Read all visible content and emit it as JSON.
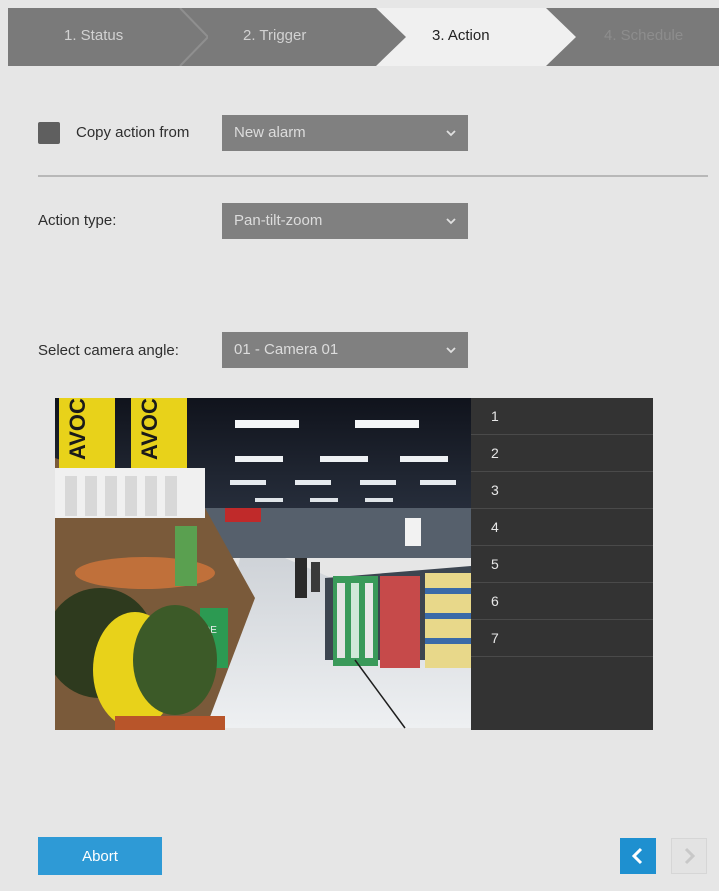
{
  "wizard": {
    "steps": [
      {
        "label": "1. Status",
        "state": "done"
      },
      {
        "label": "2. Trigger",
        "state": "done"
      },
      {
        "label": "3. Action",
        "state": "active"
      },
      {
        "label": "4. Schedule",
        "state": "pending"
      }
    ]
  },
  "copy_action": {
    "checkbox_checked": false,
    "label": "Copy action from",
    "select_value": "New alarm"
  },
  "action_type": {
    "label": "Action type:",
    "select_value": "Pan-tilt-zoom"
  },
  "camera_angle": {
    "label": "Select camera angle:",
    "select_value": "01 - Camera 01"
  },
  "camera_view": {
    "sign_text": "AVOC"
  },
  "presets": [
    "1",
    "2",
    "3",
    "4",
    "5",
    "6",
    "7"
  ],
  "footer": {
    "abort_label": "Abort",
    "prev_icon": "chevron-left-icon",
    "next_icon": "chevron-right-icon"
  },
  "colors": {
    "accent": "#1e90d0",
    "abort": "#2e9ad6",
    "wizard_bg": "#7a7a7a",
    "select_bg": "#808080",
    "preset_bg": "#333333"
  }
}
